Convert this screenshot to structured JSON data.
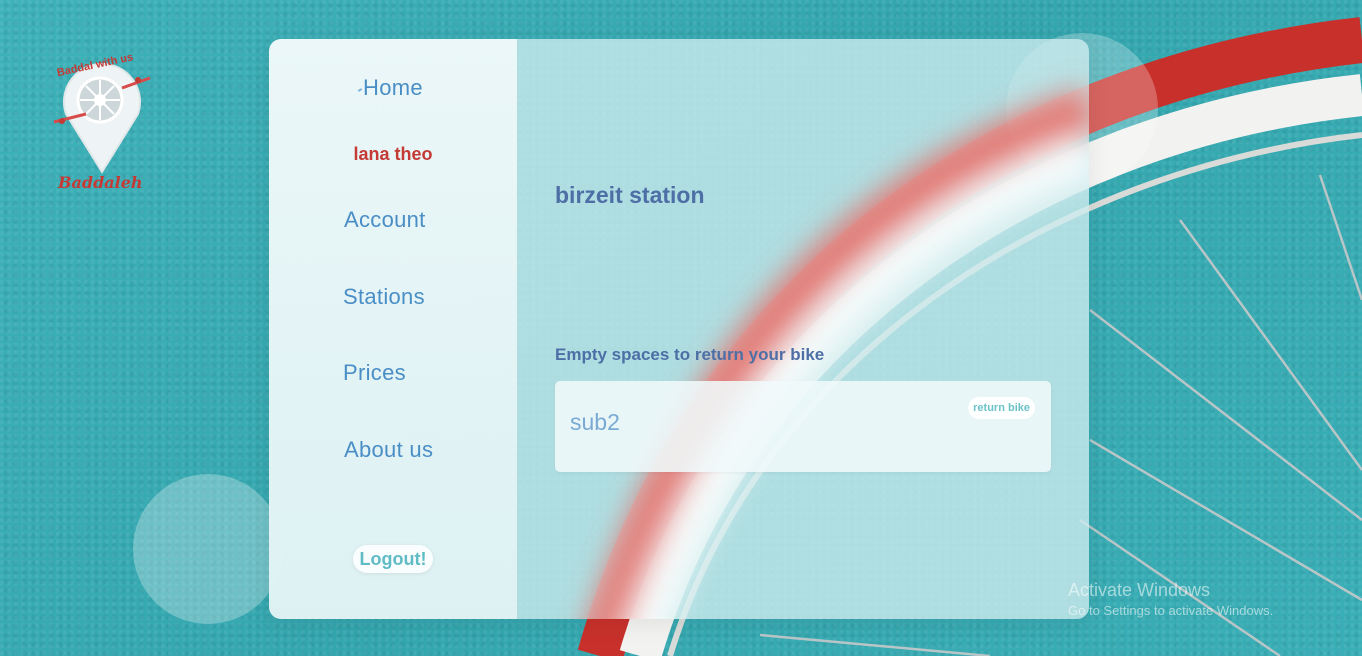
{
  "brand": {
    "logo_text_top": "Baddal with us",
    "logo_text_bottom": "Baddaleh",
    "colors": {
      "accent_red": "#c43a35",
      "nav_blue": "#4a8ec6",
      "teal": "#3fb1b9",
      "heading": "#4d6fa6"
    }
  },
  "sidebar": {
    "home_label": "Home",
    "home_icon": "home-icon",
    "user_name": "lana theo",
    "items": [
      {
        "label": "Account"
      },
      {
        "label": "Stations"
      },
      {
        "label": "Prices"
      },
      {
        "label": "About us"
      }
    ],
    "logout_label": "Logout!"
  },
  "main": {
    "station_title": "birzeit station",
    "section_label": "Empty spaces to return your bike",
    "slots": [
      {
        "name": "sub2",
        "action_label": "return bike"
      }
    ]
  },
  "watermark": {
    "line1": "Activate Windows",
    "line2": "Go to Settings to activate Windows."
  }
}
